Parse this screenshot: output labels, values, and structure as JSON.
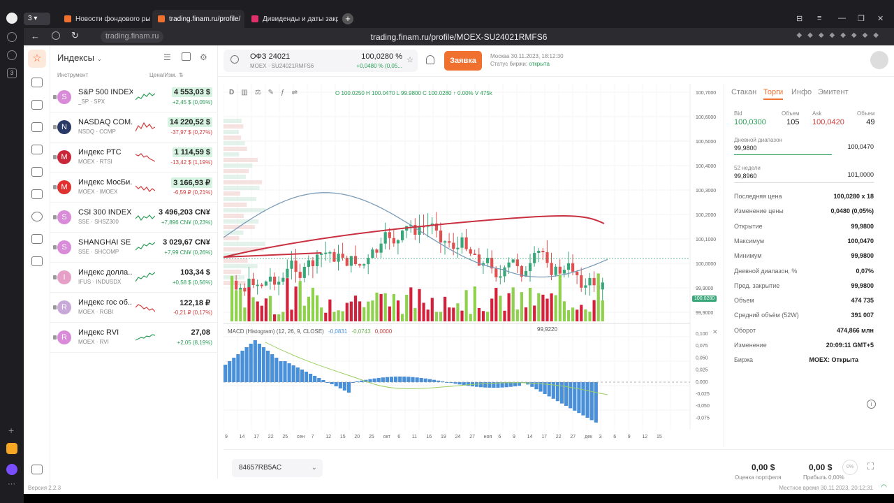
{
  "browser": {
    "tabs": [
      {
        "label": "Новости фондового рын"
      },
      {
        "label": "trading.finam.ru/profile/"
      },
      {
        "label": "Дивиденды и даты закры"
      }
    ],
    "domain_pill": "trading.finam.ru",
    "url": "trading.finam.ru/profile/MOEX-SU24021RMFS6"
  },
  "sidebar": {
    "title": "Индексы",
    "col_instrument": "Инструмент",
    "col_price": "Цена/Изм.",
    "items": [
      {
        "name": "S&P 500 INDEX",
        "sub": "_SP · SPX",
        "price": "4 553,03 $",
        "change": "+2,45 $ (0,05%)",
        "dir": "up",
        "avatar": "S",
        "color": "#d98bd9"
      },
      {
        "name": "NASDAQ COM...",
        "sub": "NSDQ · CCMP",
        "price": "14 220,52 $",
        "change": "-37,97 $ (0,27%)",
        "dir": "down",
        "avatar": "N",
        "color": "#2a3a66"
      },
      {
        "name": "Индекс РТС",
        "sub": "MOEX · RTSI",
        "price": "1 114,59 $",
        "change": "-13,42 $ (1,19%)",
        "dir": "down",
        "avatar": "M",
        "color": "#c9263a"
      },
      {
        "name": "Индекс МосБи...",
        "sub": "MOEX · IMOEX",
        "price": "3 166,93 ₽",
        "change": "-6,59 ₽ (0,21%)",
        "dir": "down",
        "avatar": "M",
        "color": "#e03030"
      },
      {
        "name": "CSI 300 INDEX",
        "sub": "SSE · SHSZ300",
        "price": "3 496,203 CN¥",
        "change": "+7,896 CN¥ (0,23%)",
        "dir": "up",
        "avatar": "S",
        "color": "#d98bd9"
      },
      {
        "name": "SHANGHAI SE ...",
        "sub": "SSE · SHCOMP",
        "price": "3 029,67 CN¥",
        "change": "+7,99 CN¥ (0,26%)",
        "dir": "up",
        "avatar": "S",
        "color": "#d98bd9"
      },
      {
        "name": "Индекс долла...",
        "sub": "IFUS · INDUSDX",
        "price": "103,34 $",
        "change": "+0,58 $ (0,56%)",
        "dir": "up",
        "avatar": "I",
        "color": "#e6a0c8"
      },
      {
        "name": "Индекс гос об...",
        "sub": "MOEX · RGBI",
        "price": "122,18 ₽",
        "change": "-0,21 ₽ (0,17%)",
        "dir": "down",
        "avatar": "R",
        "color": "#c8a8d8"
      },
      {
        "name": "Индекс RVI",
        "sub": "MOEX · RVI",
        "price": "27,08",
        "change": "+2,05 (8,19%)",
        "dir": "up",
        "avatar": "R",
        "color": "#d98bd9"
      }
    ]
  },
  "instrument": {
    "name": "ОФЗ 24021",
    "sub": "MOEX · SU24021RMFS6",
    "price": "100,0280 %",
    "change": "+0,0480 % (0,05...",
    "order_button": "Заявка",
    "time": "Москва 30.11.2023, 18:12:30",
    "status_label": "Статус биржи:",
    "status_value": "открыта"
  },
  "chart": {
    "interval": "D",
    "ohlc": "O 100.0250  H 100.0470  L 99.9800  C 100.0280  ↑ 0.00%  V 475k",
    "price_labels": [
      "100,7000",
      "100,6000",
      "100,5000",
      "100,4000",
      "100,3000",
      "100,2000",
      "100,1000",
      "100,0000",
      "99,9000",
      "99,9000"
    ],
    "current_price": "100,0280",
    "low_marker": "99,9220",
    "macd_title": "MACD (Histogram) (12, 26, 9, CLOSE)",
    "macd_vals": [
      "-0,0831",
      "-0,0743",
      "0,0000"
    ],
    "macd_labels": [
      "0,100",
      "0,075",
      "0,050",
      "0,025",
      "0,000",
      "-0,025",
      "-0,050",
      "-0,075"
    ],
    "x_labels": [
      "9",
      "14",
      "17",
      "22",
      "25",
      "сен",
      "7",
      "12",
      "15",
      "20",
      "25",
      "окт",
      "6",
      "11",
      "16",
      "19",
      "24",
      "27",
      "ноя",
      "6",
      "9",
      "14",
      "17",
      "22",
      "27",
      "дек",
      "3",
      "6",
      "9",
      "12",
      "15"
    ]
  },
  "right_panel": {
    "tabs": [
      "Стакан",
      "Торги",
      "Инфо",
      "Эмитент"
    ],
    "bid_label": "Bid",
    "bid": "100,0300",
    "vol_label": "Объем",
    "bid_vol": "105",
    "ask_label": "Ask",
    "ask": "100,0420",
    "ask_vol": "49",
    "day_range_label": "Дневной диапазон",
    "day_low": "99,9800",
    "day_high": "100,0470",
    "weeks_label": "52 недели",
    "w_low": "99,8960",
    "w_high": "101,0000",
    "stats": [
      {
        "k": "Последняя цена",
        "v": "100,0280 x 18"
      },
      {
        "k": "Изменение цены",
        "v": "0,0480 (0,05%)"
      },
      {
        "k": "Открытие",
        "v": "99,9800"
      },
      {
        "k": "Максимум",
        "v": "100,0470"
      },
      {
        "k": "Минимум",
        "v": "99,9800"
      },
      {
        "k": "Дневной диапазон, %",
        "v": "0,07%"
      },
      {
        "k": "Пред. закрытие",
        "v": "99,9800"
      },
      {
        "k": "Объем",
        "v": "474 735"
      },
      {
        "k": "Средний объём (52W)",
        "v": "391 007"
      },
      {
        "k": "Оборот",
        "v": "474,866 млн"
      },
      {
        "k": "Изменение",
        "v": "20:09:11 GMT+5"
      },
      {
        "k": "Биржа",
        "v": "MOEX: Открыта"
      }
    ]
  },
  "bottom": {
    "account": "84657RB5AC",
    "portfolio_value": "0,00 $",
    "portfolio_label": "Оценка портфеля",
    "profit_value": "0,00 $",
    "profit_label": "Прибыль 0,00%",
    "percent_badge": "0%"
  },
  "footer": {
    "version": "Версия 2.2.3",
    "local_time": "Местное время 30.11.2023, 20:12:31"
  },
  "colors": {
    "up": "#2a9d57",
    "down": "#d23c3c",
    "accent": "#f07030",
    "green_candle": "#3aa77a",
    "red_candle": "#e05050"
  }
}
